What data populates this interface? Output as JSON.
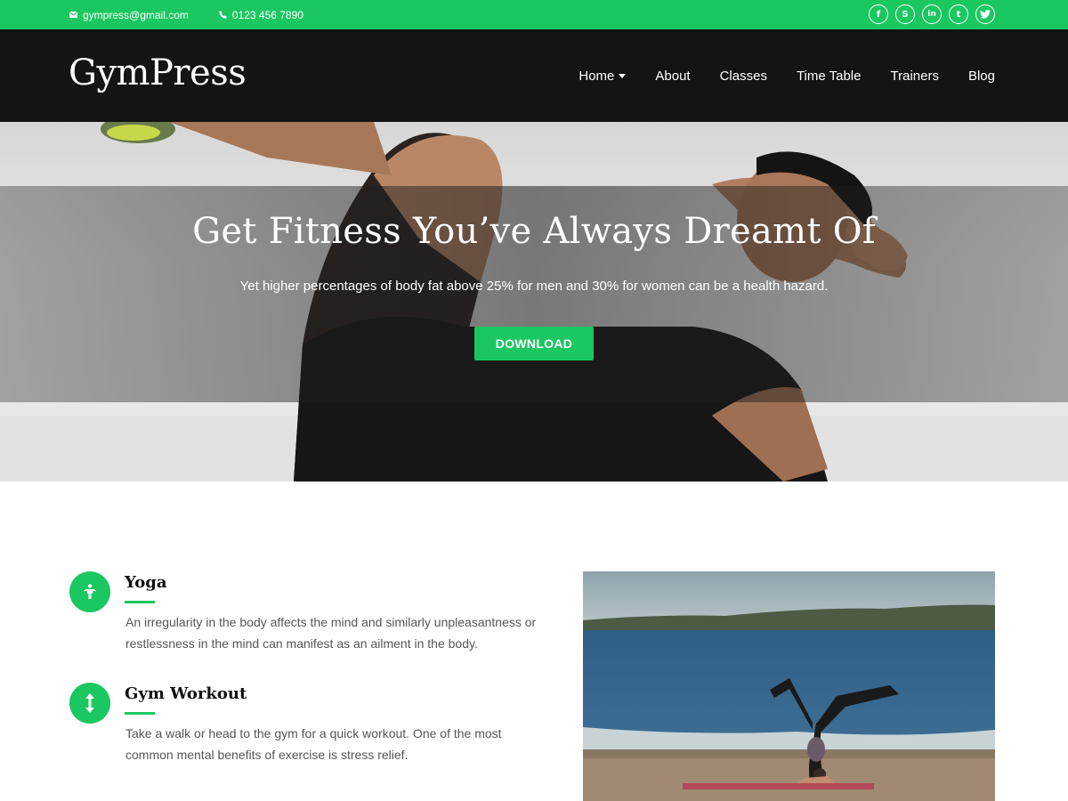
{
  "topbar": {
    "email": "gympress@gmail.com",
    "phone": "0123 456 7890",
    "socials": [
      {
        "icon": "facebook-icon",
        "glyph": "f"
      },
      {
        "icon": "skype-icon",
        "glyph": "S"
      },
      {
        "icon": "linkedin-icon",
        "glyph": "in"
      },
      {
        "icon": "tumblr-icon",
        "glyph": "t"
      },
      {
        "icon": "twitter-icon",
        "glyph": "🐦"
      }
    ]
  },
  "header": {
    "logo": "GymPress",
    "nav": [
      {
        "label": "Home",
        "has_dropdown": true
      },
      {
        "label": "About"
      },
      {
        "label": "Classes"
      },
      {
        "label": "Time Table"
      },
      {
        "label": "Trainers"
      },
      {
        "label": "Blog"
      }
    ]
  },
  "hero": {
    "title": "Get Fitness You’ve Always Dreamt Of",
    "subtitle": "Yet higher percentages of body fat above 25% for men and 30% for women can be a health hazard.",
    "button": "DOWNLOAD"
  },
  "features": [
    {
      "icon": "person-icon",
      "title": "Yoga",
      "text": "An irregularity in the body affects the mind and similarly unpleasantness or restlessness in the mind can manifest as an ailment in the body."
    },
    {
      "icon": "vertical-arrows-icon",
      "title": "Gym Workout",
      "text": "Take a walk or head to the gym for a quick workout. One of the most common mental benefits of exercise is stress relief."
    }
  ],
  "colors": {
    "accent": "#1bc760",
    "header_bg": "#141414"
  }
}
